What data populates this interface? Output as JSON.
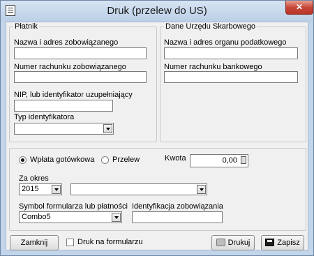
{
  "window": {
    "title": "Druk (przelew do US)",
    "close_label": "✕"
  },
  "payer": {
    "legend": "Płatnik",
    "name_label": "Nazwa i adres zobowiązanego",
    "name_value": "",
    "account_label": "Numer rachunku zobowiązanego",
    "account_value": "",
    "nip_label": "NIP, lub identyfikator uzupełniający",
    "nip_value": "",
    "id_type_label": "Typ identyfikatora",
    "id_type_value": ""
  },
  "tax_office": {
    "legend": "Dane Urzędu Skarbowego",
    "name_label": "Nazwa i adres organu podatkowego",
    "name_value": "",
    "account_label": "Numer rachunku bankowego",
    "account_value": ""
  },
  "payment": {
    "cash_label": "Wpłata gotówkowa",
    "cash_selected": true,
    "transfer_label": "Przelew",
    "transfer_selected": false,
    "amount_label": "Kwota",
    "amount_value": "0,00",
    "period_label": "Za okres",
    "year_value": "2015",
    "period_value": "",
    "symbol_label": "Symbol formularza lub płatności",
    "symbol_value": "Combo5",
    "obligation_id_label": "Identyfikacja zobowiązania",
    "obligation_id_value": ""
  },
  "footer": {
    "close_label": "Zamknij",
    "print_on_form_label": "Druk na formularzu",
    "print_on_form_checked": false,
    "print_label": "Drukuj",
    "save_label": "Zapisz"
  }
}
